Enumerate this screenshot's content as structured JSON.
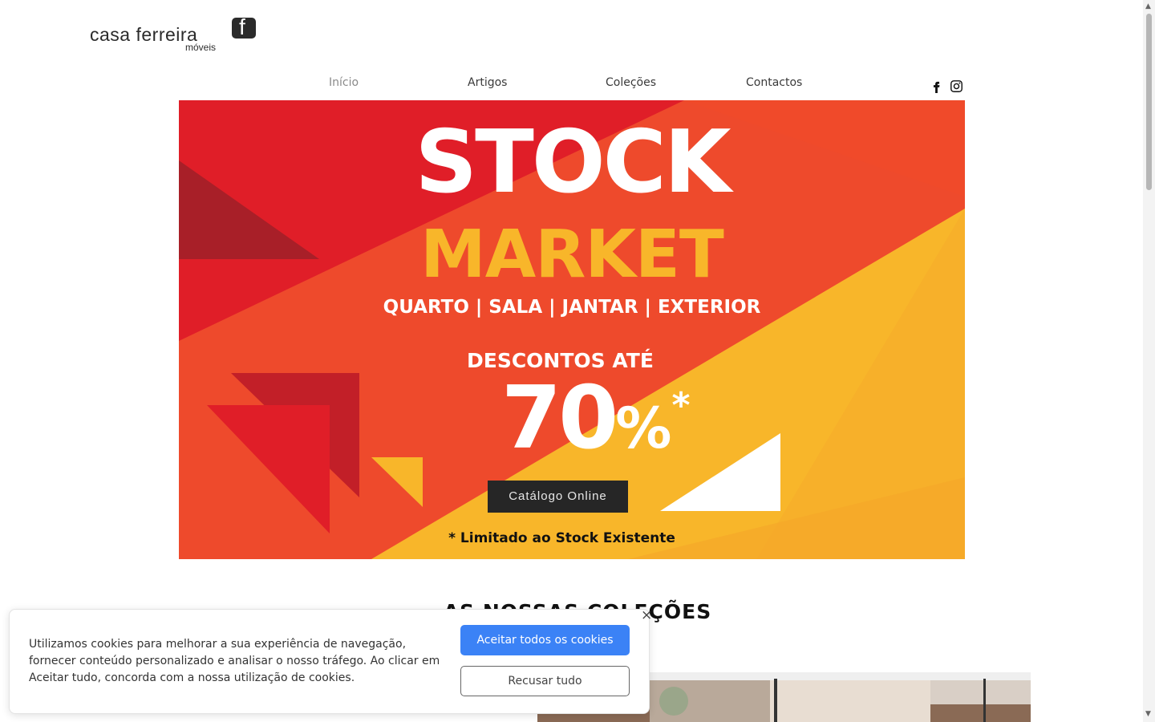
{
  "brand": {
    "name": "casa ferreira",
    "sub": "móveis",
    "mark": "f"
  },
  "nav": {
    "items": [
      "Início",
      "Artigos",
      "Coleções",
      "Contactos"
    ],
    "active": "Início"
  },
  "social": [
    "facebook-icon",
    "instagram-icon"
  ],
  "hero": {
    "line1": "STOCK",
    "line2": "MARKET",
    "categories": "QUARTO | SALA | JANTAR | EXTERIOR",
    "discount_label": "DESCONTOS ATÉ",
    "discount_value": "70",
    "discount_symbol": "%",
    "asterisk": "*",
    "button": "Catálogo Online",
    "note": "* Limitado ao Stock Existente",
    "colors": {
      "red": "#e01e28",
      "orange": "#ee4a2c",
      "yellow": "#f8b62a",
      "dark_red": "#a81f28"
    }
  },
  "section": {
    "title": "AS NOSSAS COLEÇÕES"
  },
  "cookie": {
    "text": "Utilizamos cookies para melhorar a sua experiência de navegação, fornecer conteúdo personalizado e analisar o nosso tráfego. Ao clicar em Aceitar tudo, concorda com a nossa utilização de cookies.",
    "accept": "Aceitar todos os cookies",
    "refuse": "Recusar tudo",
    "close": "×"
  },
  "theme": {
    "accent": "#3b82f6"
  }
}
